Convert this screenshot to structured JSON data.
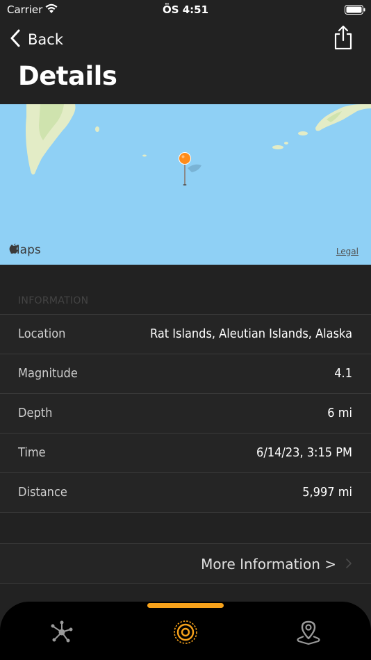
{
  "status_bar": {
    "carrier": "Carrier",
    "time": "ÖS 4:51"
  },
  "nav": {
    "back_label": "Back",
    "title": "Details"
  },
  "map": {
    "brand_label": "Maps",
    "legal_label": "Legal",
    "pin_color": "#ff8c1a"
  },
  "info": {
    "section_header": "INFORMATION",
    "rows": [
      {
        "label": "Location",
        "value": "Rat Islands, Aleutian Islands, Alaska"
      },
      {
        "label": "Magnitude",
        "value": "4.1"
      },
      {
        "label": "Depth",
        "value": "6 mi"
      },
      {
        "label": "Time",
        "value": "6/14/23, 3:15 PM"
      },
      {
        "label": "Distance",
        "value": "5,997 mi"
      }
    ]
  },
  "more_info": {
    "label": "More Information >"
  },
  "tab_bar": {
    "accent_color": "#f7a21b",
    "tabs": [
      {
        "icon": "network-icon"
      },
      {
        "icon": "target-icon"
      },
      {
        "icon": "location-pin-icon"
      }
    ]
  }
}
